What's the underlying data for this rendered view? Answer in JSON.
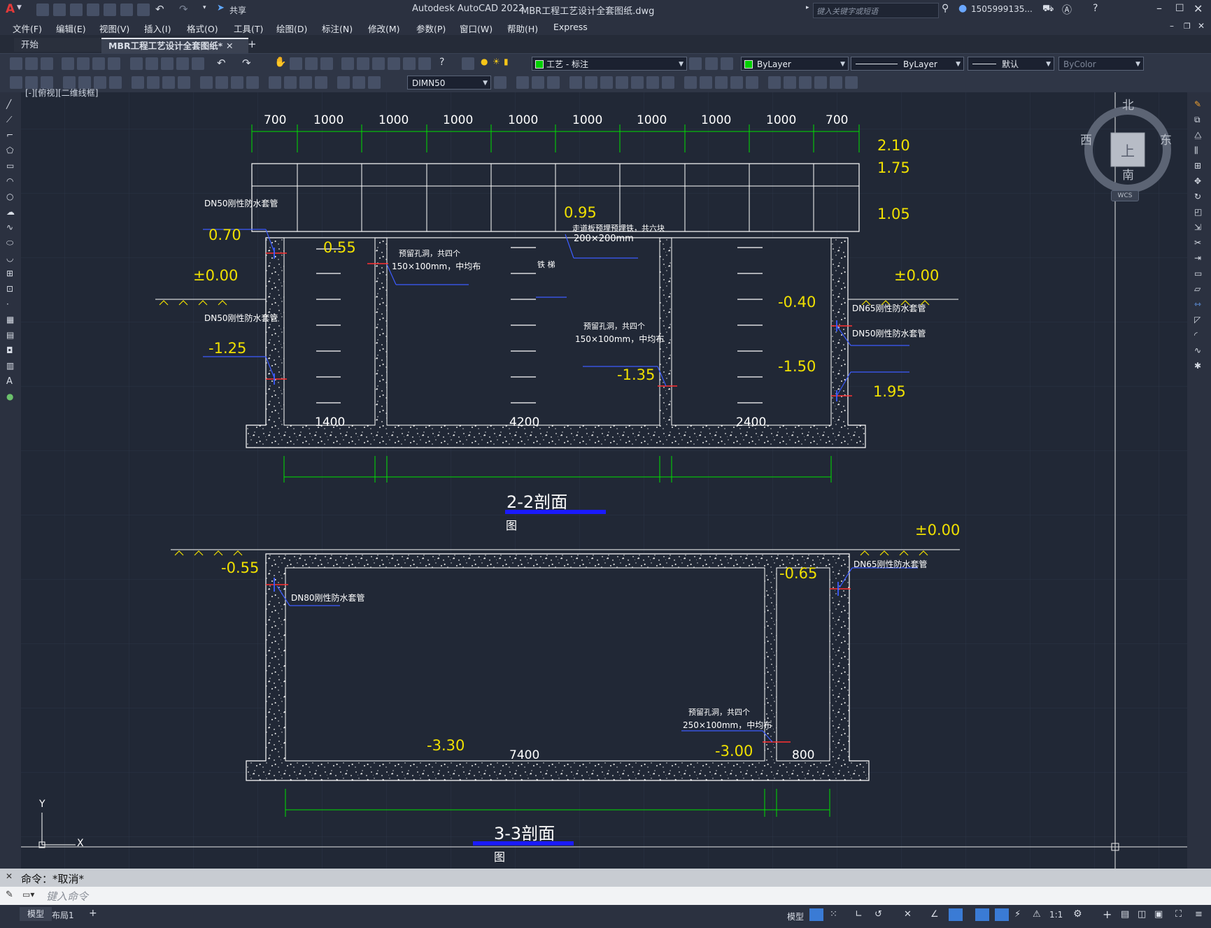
{
  "window": {
    "app_title": "Autodesk AutoCAD 2022",
    "file_title": "MBR工程工艺设计全套图纸.dwg",
    "share_label": "共享",
    "search_placeholder": "键入关键字或短语",
    "user": "1505999135...",
    "app_letter": "A"
  },
  "menu": [
    "文件(F)",
    "编辑(E)",
    "视图(V)",
    "插入(I)",
    "格式(O)",
    "工具(T)",
    "绘图(D)",
    "标注(N)",
    "修改(M)",
    "参数(P)",
    "窗口(W)",
    "帮助(H)",
    "Express"
  ],
  "tabs": {
    "start": "开始",
    "active": "MBR工程工艺设计全套图纸*",
    "add": "+"
  },
  "toolbar": {
    "layer": "工艺 - 标注",
    "color": "ByLayer",
    "linetype": "ByLayer",
    "lineweight": "默认",
    "plotstyle": "ByColor",
    "dimstyle": "DIMN50",
    "layer_color": "#00d000"
  },
  "viewport_label": "[-][俯视][二维线框]",
  "viewcube": {
    "north": "北",
    "south": "南",
    "east": "东",
    "west": "西",
    "face": "上",
    "wcs": "WCS"
  },
  "ucs": {
    "x": "X",
    "y": "Y"
  },
  "drawing": {
    "section22": {
      "top_dims": [
        "700",
        "1000",
        "1000",
        "1000",
        "1000",
        "1000",
        "1000",
        "1000",
        "1000",
        "700"
      ],
      "bottom_dims": [
        "1400",
        "4200",
        "2400"
      ],
      "title": "2-2剖面",
      "title_sub": "图",
      "elev_210": "2.10",
      "elev_175": "1.75",
      "elev_105": "1.05",
      "elev_095": "0.95",
      "elev_070": "0.70",
      "elev_055": "0.55",
      "elev_000_left": "±0.00",
      "elev_000_right": "±0.00",
      "elev_m040": "-0.40",
      "elev_m125": "-1.25",
      "elev_m135": "-1.35",
      "elev_m150": "-1.50",
      "elev_195": "1.95",
      "note_dn50_top": "DN50刚性防水套管",
      "note_dn50_bottom": "DN50刚性防水套管",
      "note_dn65": "DN65刚性防水套管",
      "note_dn50_right": "DN50刚性防水套管",
      "note_hole1_a": "预留孔洞，共四个",
      "note_hole1_b": "150×100mm，中均布",
      "note_hole2_a": "预留孔洞，共四个",
      "note_hole2_b": "150×100mm，中均布",
      "note_plate_a": "走道板预埋预埋铁，共六块",
      "note_plate_b": "200×200mm",
      "note_ladder": "铁 梯"
    },
    "section33": {
      "bottom_dims": [
        "7400",
        "800"
      ],
      "title": "3-3剖面",
      "title_sub": "图",
      "elev_000": "±0.00",
      "elev_m055": "-0.55",
      "elev_m065": "-0.65",
      "elev_m330": "-3.30",
      "elev_m300": "-3.00",
      "note_dn80": "DN80刚性防水套管",
      "note_dn65": "DN65刚性防水套管",
      "note_hole_a": "预留孔洞，共四个",
      "note_hole_b": "250×100mm，中均布"
    }
  },
  "command": {
    "history": "命令：*取消*",
    "placeholder": "键入命令"
  },
  "layout_tabs": [
    "模型",
    "布局1"
  ],
  "status": {
    "model": "模型",
    "scale": "1:1"
  }
}
